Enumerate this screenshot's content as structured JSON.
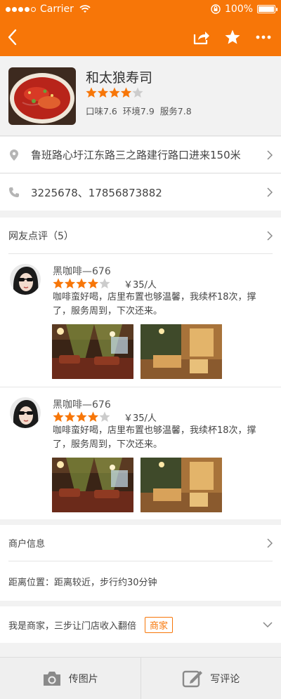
{
  "status_bar": {
    "carrier": "Carrier",
    "battery": "100%"
  },
  "shop": {
    "name": "和太狼寿司",
    "rating": 4,
    "scores": [
      "口味7.6",
      "环境7.9",
      "服务7.8"
    ]
  },
  "address": "鲁班路心圩江东路三之路建行路口进来150米",
  "phone": "3225678、17856873882",
  "reviews": {
    "header": "网友点评（5）",
    "items": [
      {
        "user": "黑咖啡—676",
        "rating": 4,
        "price": "￥35/人",
        "text": "咖啡蛮好喝，店里布置也够温馨，我续杯18次，撑了，服务周到，下次还来。"
      },
      {
        "user": "黑咖啡—676",
        "rating": 4,
        "price": "￥35/人",
        "text": "咖啡蛮好喝，店里布置也够温馨，我续杯18次，撑了，服务周到，下次还来。"
      }
    ]
  },
  "merchant": {
    "info_label": "商户信息",
    "distance": "距离位置：距离较近，步行约30分钟"
  },
  "owner": {
    "text": "我是商家，三步让门店收入翻倍",
    "badge": "商家"
  },
  "footer": {
    "photo_label": "传图片",
    "review_label": "写评论"
  },
  "colors": {
    "brand": "#f77608",
    "star_on": "#f77608",
    "star_off": "#cccccc"
  }
}
